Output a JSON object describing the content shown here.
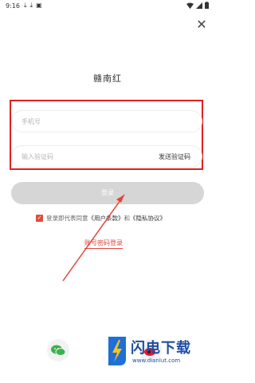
{
  "status_bar": {
    "time": "9:16"
  },
  "app_title": "赣南红",
  "phone_field": {
    "placeholder": "手机号",
    "value": ""
  },
  "code_field": {
    "placeholder": "输入验证码",
    "value": ""
  },
  "send_code_label": "发送验证码",
  "login_label": "登录",
  "agreement": {
    "prefix": "登录即代表同意",
    "user_terms": "《用户条款》",
    "and": "和",
    "privacy": "《隐私协议》",
    "checked": true
  },
  "password_login_label": "账号密码登录",
  "social": [
    {
      "name": "wechat",
      "icon": "wechat-icon"
    },
    {
      "name": "weibo",
      "icon": "weibo-icon"
    }
  ],
  "watermark": {
    "title": "闪电下载",
    "url": "www.dianlut.com"
  },
  "colors": {
    "highlight_box": "#e02020",
    "login_button": "#d6d6d6",
    "link_red": "#e0473a",
    "wechat_green": "#3bb34a"
  }
}
